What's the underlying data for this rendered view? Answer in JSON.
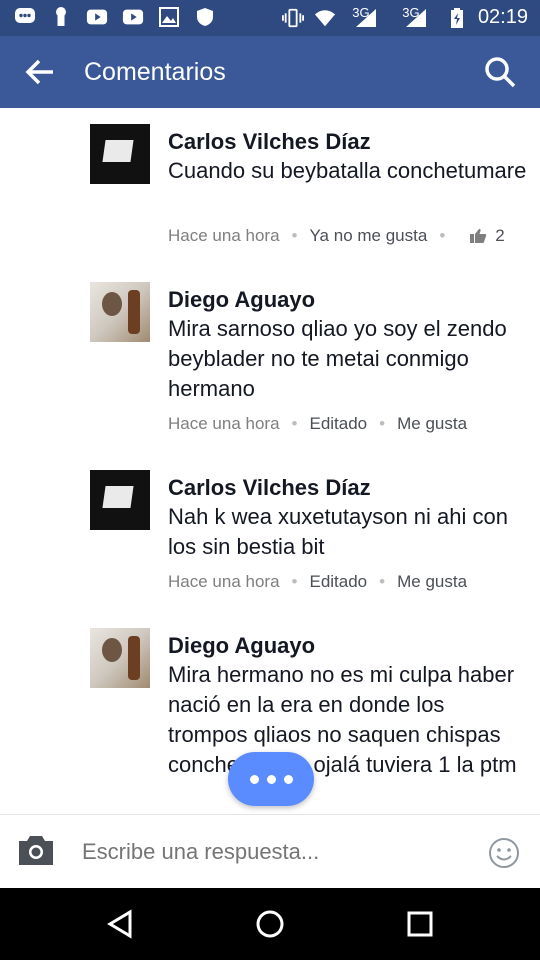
{
  "status_bar": {
    "network_left": "3G",
    "network_right": "3G",
    "time": "02:19"
  },
  "app_bar": {
    "title": "Comentarios",
    "back_icon": "back-arrow-icon",
    "search_icon": "search-icon"
  },
  "comments": [
    {
      "author": "Carlos Vilches Díaz",
      "text": "Cuando su beybatalla conchetumare",
      "time": "Hace una hora",
      "action": "Ya no me gusta",
      "likes": "2"
    },
    {
      "author": "Diego Aguayo",
      "text": "Mira sarnoso qliao yo soy el zendo beyblader no te metai conmigo hermano",
      "time": "Hace una hora",
      "edited": "Editado",
      "action": "Me gusta"
    },
    {
      "author": "Carlos Vilches Díaz",
      "text": "Nah k wea xuxetutayson ni ahi con los sin bestia bit",
      "time": "Hace una hora",
      "edited": "Editado",
      "action": "Me gusta"
    },
    {
      "author": "Diego Aguayo",
      "text": "Mira hermano no es mi culpa haber nació en la era en donde los trompos qliaos no saquen chispas conchetumare ojalá tuviera 1 la ptm"
    }
  ],
  "composer": {
    "placeholder": "Escribe una respuesta..."
  },
  "colors": {
    "status_bar": "#2f4a80",
    "app_bar": "#3b5998",
    "bubble": "#5b8cff"
  }
}
